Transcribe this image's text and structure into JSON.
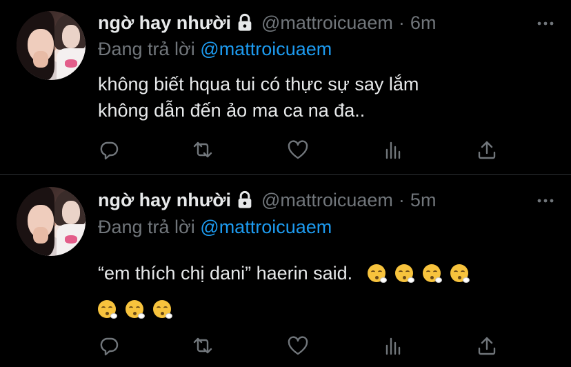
{
  "colors": {
    "background": "#000000",
    "text": "#e7e9ea",
    "muted": "#71767b",
    "mention": "#1d9bf0",
    "divider": "#2f3336"
  },
  "tweets": [
    {
      "display_name": "ngờ hay nhười",
      "handle": "@mattroicuaem",
      "separator": "·",
      "time": "6m",
      "reply_prefix": "Đang trả lời",
      "reply_to": "@mattroicuaem",
      "text_lines": [
        "không biết hqua tui có thực sự say lắm",
        "không dẫn đến ảo ma ca na đa.."
      ],
      "icons": [
        "lock-icon",
        "more-icon",
        "reply-icon",
        "retweet-icon",
        "like-icon",
        "views-icon",
        "share-icon"
      ]
    },
    {
      "display_name": "ngờ hay nhười",
      "handle": "@mattroicuaem",
      "separator": "·",
      "time": "5m",
      "reply_prefix": "Đang trả lời",
      "reply_to": "@mattroicuaem",
      "text": "“em thích chị dani” haerin said.",
      "emoji_count": 7,
      "emoji_name": "face-exhaling-emoji",
      "icons": [
        "lock-icon",
        "more-icon",
        "reply-icon",
        "retweet-icon",
        "like-icon",
        "views-icon",
        "share-icon"
      ]
    }
  ]
}
